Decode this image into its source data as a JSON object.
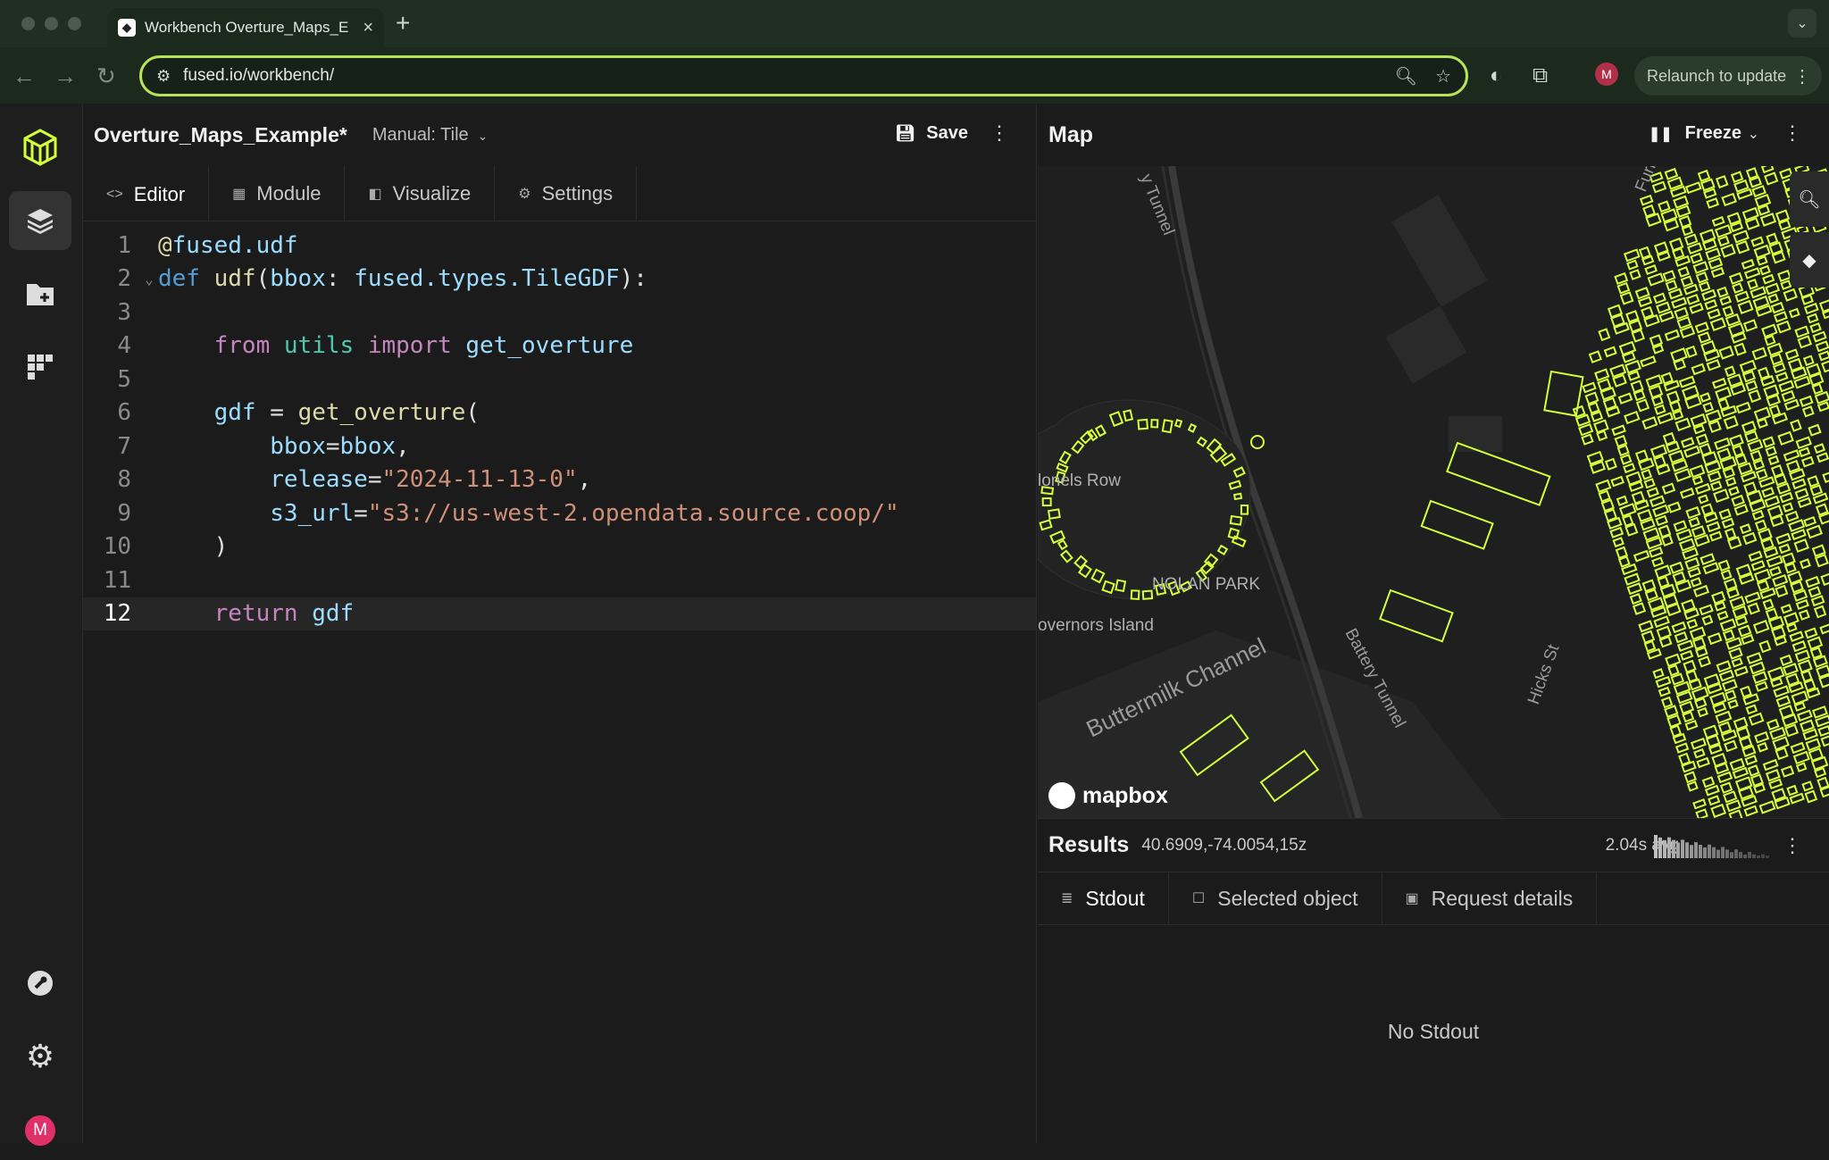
{
  "browser": {
    "tab_title": "Workbench Overture_Maps_E",
    "url": "fused.io/workbench/",
    "profile_initial": "M",
    "relaunch_label": "Relaunch to update"
  },
  "rail": {
    "avatar_initial": "M"
  },
  "editor": {
    "udf_name": "Overture_Maps_Example*",
    "mode_label": "Manual: Tile",
    "save_label": "Save",
    "tabs": [
      {
        "label": "Editor"
      },
      {
        "label": "Module"
      },
      {
        "label": "Visualize"
      },
      {
        "label": "Settings"
      }
    ],
    "current_line": 12,
    "line_numbers": [
      "1",
      "2",
      "3",
      "4",
      "5",
      "6",
      "7",
      "8",
      "9",
      "10",
      "11",
      "12"
    ]
  },
  "code": {
    "l1_at": "@",
    "l1_dec": "fused.udf",
    "l2_def": "def",
    "l2_name": " udf",
    "l2_open": "(",
    "l2_arg": "bbox",
    "l2_colon": ": ",
    "l2_type": "fused.types.TileGDF",
    "l2_close": "):",
    "l4_indent": "    ",
    "l4_from": "from",
    "l4_mod": " utils ",
    "l4_import": "import",
    "l4_name": " get_overture",
    "l6_indent": "    ",
    "l6_var": "gdf",
    "l6_eq": " = ",
    "l6_fn": "get_overture",
    "l6_open": "(",
    "l7_indent": "        ",
    "l7_key": "bbox",
    "l7_eq": "=",
    "l7_val": "bbox",
    "l7_comma": ",",
    "l8_indent": "        ",
    "l8_key": "release",
    "l8_eq": "=",
    "l8_val": "\"2024-11-13-0\"",
    "l8_comma": ",",
    "l9_indent": "        ",
    "l9_key": "s3_url",
    "l9_eq": "=",
    "l9_val": "\"s3://us-west-2.opendata.source.coop/\"",
    "l10_text": "    )",
    "l12_indent": "    ",
    "l12_return": "return",
    "l12_var": " gdf"
  },
  "map": {
    "title": "Map",
    "freeze_label": "Freeze",
    "labels": {
      "tunnel": "y Tunnel",
      "colonels_row": "lonels Row",
      "nolan_park": "NOLAN PARK",
      "governors": "overnors Island",
      "buttermilk": "Buttermilk Channel",
      "battery": "Battery Tunnel",
      "furman": "Furman St",
      "hicks": "Hicks St"
    },
    "attribution": "mapbox",
    "building_color": "#d4ff3a"
  },
  "results": {
    "title": "Results",
    "coords": "40.6909,-74.0054,15z",
    "avg": "2.04s avg",
    "tabs": [
      {
        "label": "Stdout"
      },
      {
        "label": "Selected object"
      },
      {
        "label": "Request details"
      }
    ],
    "empty_text": "No Stdout"
  }
}
